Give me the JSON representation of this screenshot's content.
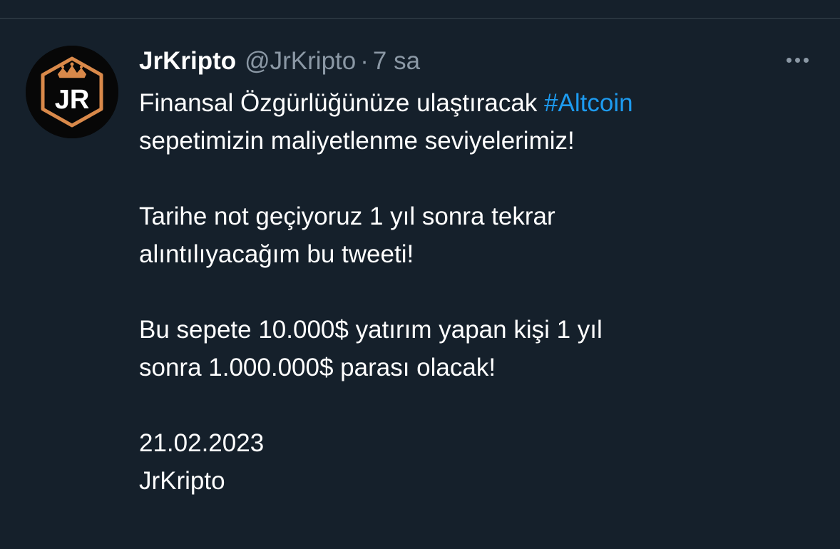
{
  "tweet": {
    "display_name": "JrKripto",
    "handle": "@JrKripto",
    "separator": "·",
    "time": "7 sa",
    "avatar_text": "JR",
    "body": {
      "line1_pre": "Finansal Özgürlüğünüze ulaştıracak ",
      "hashtag": "#Altcoin",
      "line2": "sepetimizin maliyetlenme seviyelerimiz!",
      "line3": "Tarihe not geçiyoruz 1 yıl sonra tekrar",
      "line4": "alıntılıyacağım bu tweeti!",
      "line5": "Bu sepete 10.000$ yatırım yapan kişi 1 yıl",
      "line6": "sonra 1.000.000$ parası olacak!",
      "line7": "21.02.2023",
      "line8": "JrKripto"
    }
  },
  "colors": {
    "background": "#15202b",
    "text": "#ffffff",
    "secondary_text": "#8b98a5",
    "link": "#1d9bf0",
    "avatar_accent": "#d9894a"
  },
  "icons": {
    "more": "more-horizontal-icon",
    "crown": "crown-icon"
  }
}
